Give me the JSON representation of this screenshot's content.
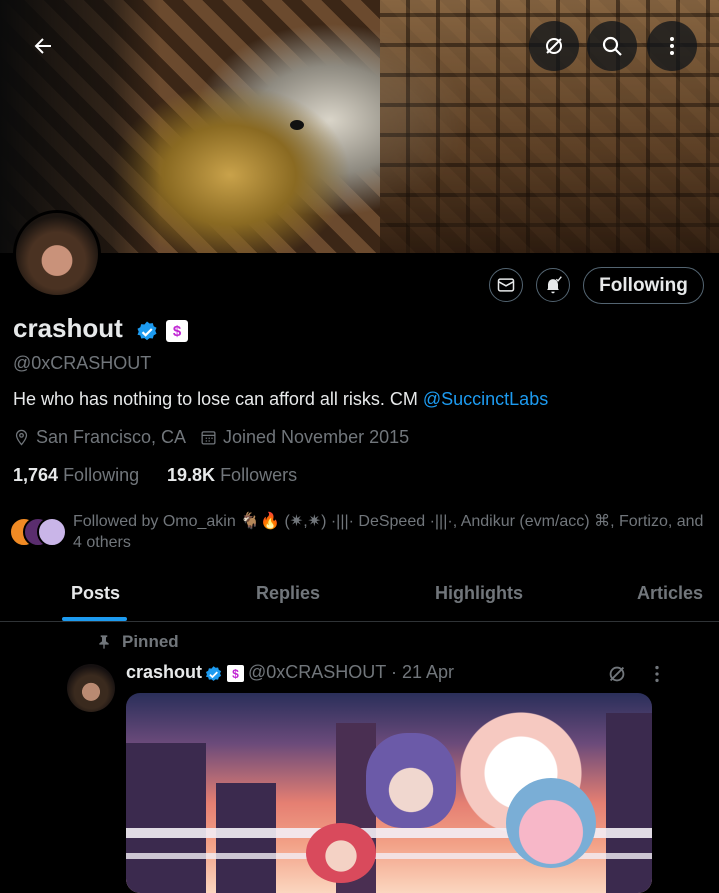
{
  "header": {
    "back_icon": "arrow-left-icon",
    "grok_icon": "grok-icon",
    "search_icon": "search-icon",
    "more_icon": "more-vertical-icon"
  },
  "profile": {
    "name": "crashout",
    "handle": "@0xCRASHOUT",
    "affiliate_badge": "$",
    "bio_text": "He who has nothing to lose can afford all risks.  CM ",
    "bio_link": "@SuccinctLabs",
    "location": "San Francisco, CA",
    "joined": "Joined November 2015",
    "following_count": "1,764",
    "following_label": "Following",
    "followers_count": "19.8K",
    "followers_label": "Followers",
    "followed_by": "Followed by Omo_akin 🐐🔥 (✷,✷) ·|||· DeSpeed ·|||·, Andikur (evm/acc) ⌘, Fortizo, and 4 others"
  },
  "actions": {
    "message_icon": "mail-icon",
    "notify_icon": "bell-check-icon",
    "following_button": "Following"
  },
  "tabs": [
    {
      "label": "Posts",
      "active": true
    },
    {
      "label": "Replies",
      "active": false
    },
    {
      "label": "Highlights",
      "active": false
    },
    {
      "label": "Articles",
      "active": false
    }
  ],
  "post": {
    "pinned_label": "Pinned",
    "author_name": "crashout",
    "author_badge": "$",
    "author_handle_date": "@0xCRASHOUT · 21 Apr"
  },
  "colors": {
    "background": "#000000",
    "accent": "#1d9bf0",
    "muted_text": "#71767b",
    "primary_text": "#e7e9ea",
    "border": "#2f3336"
  }
}
